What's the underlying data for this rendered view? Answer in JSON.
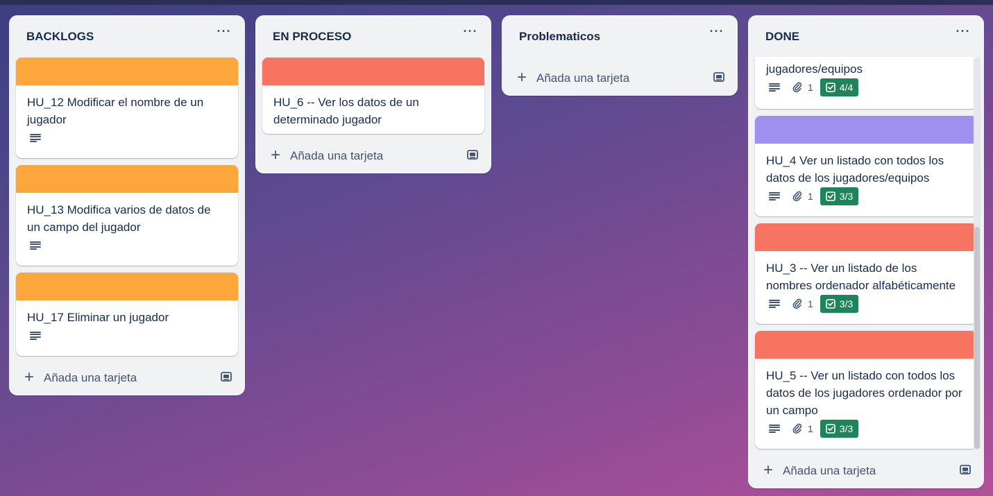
{
  "colors": {
    "orange": "#fca63b",
    "red": "#f87462",
    "purple": "#9f8fef",
    "green": "#1f845a"
  },
  "icons": {
    "menu": "ellipsis-icon",
    "add": "plus-icon",
    "template": "card-template-icon",
    "description": "description-icon",
    "attachment": "paperclip-icon",
    "checklist": "checklist-icon"
  },
  "add_card_label": "Añada una tarjeta",
  "lists": [
    {
      "title": "BACKLOGS",
      "menu": "···",
      "cards": [
        {
          "title": "HU_12 Modificar el nombre de un jugador",
          "cover": "orange"
        },
        {
          "title": "HU_13 Modifica varios de datos de un campo del jugador",
          "cover": "orange"
        },
        {
          "title": "HU_17 Eliminar un jugador",
          "cover": "orange"
        }
      ]
    },
    {
      "title": "EN PROCESO",
      "menu": "···",
      "cards": [
        {
          "title": "HU_6 -- Ver los datos de un determinado jugador",
          "cover": "red"
        }
      ]
    },
    {
      "title": "Problematicos",
      "menu": "···",
      "cards": []
    },
    {
      "title": "DONE",
      "menu": "···",
      "cards": [
        {
          "title": "jugadores/equipos",
          "attachments": "1",
          "checklist": "4/4"
        },
        {
          "title": "HU_4 Ver un listado con todos los datos de los jugadores/equipos",
          "cover": "purple",
          "attachments": "1",
          "checklist": "3/3"
        },
        {
          "title": "HU_3 -- Ver un listado de los nombres ordenador alfabéticamente",
          "cover": "red",
          "attachments": "1",
          "checklist": "3/3"
        },
        {
          "title": "HU_5 -- Ver un listado con todos los datos de los jugadores ordenador por un campo",
          "cover": "red",
          "attachments": "1",
          "checklist": "3/3"
        }
      ]
    }
  ]
}
